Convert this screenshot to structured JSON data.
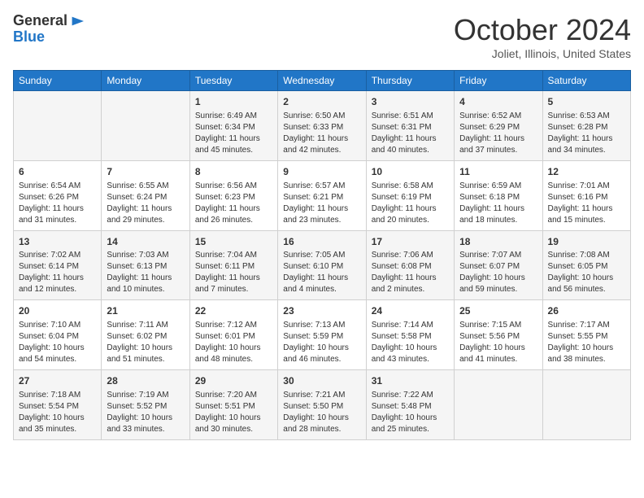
{
  "header": {
    "logo_line1": "General",
    "logo_line2": "Blue",
    "month_title": "October 2024",
    "location": "Joliet, Illinois, United States"
  },
  "days_of_week": [
    "Sunday",
    "Monday",
    "Tuesday",
    "Wednesday",
    "Thursday",
    "Friday",
    "Saturday"
  ],
  "weeks": [
    [
      {
        "day": "",
        "sunrise": "",
        "sunset": "",
        "daylight": ""
      },
      {
        "day": "",
        "sunrise": "",
        "sunset": "",
        "daylight": ""
      },
      {
        "day": "1",
        "sunrise": "Sunrise: 6:49 AM",
        "sunset": "Sunset: 6:34 PM",
        "daylight": "Daylight: 11 hours and 45 minutes."
      },
      {
        "day": "2",
        "sunrise": "Sunrise: 6:50 AM",
        "sunset": "Sunset: 6:33 PM",
        "daylight": "Daylight: 11 hours and 42 minutes."
      },
      {
        "day": "3",
        "sunrise": "Sunrise: 6:51 AM",
        "sunset": "Sunset: 6:31 PM",
        "daylight": "Daylight: 11 hours and 40 minutes."
      },
      {
        "day": "4",
        "sunrise": "Sunrise: 6:52 AM",
        "sunset": "Sunset: 6:29 PM",
        "daylight": "Daylight: 11 hours and 37 minutes."
      },
      {
        "day": "5",
        "sunrise": "Sunrise: 6:53 AM",
        "sunset": "Sunset: 6:28 PM",
        "daylight": "Daylight: 11 hours and 34 minutes."
      }
    ],
    [
      {
        "day": "6",
        "sunrise": "Sunrise: 6:54 AM",
        "sunset": "Sunset: 6:26 PM",
        "daylight": "Daylight: 11 hours and 31 minutes."
      },
      {
        "day": "7",
        "sunrise": "Sunrise: 6:55 AM",
        "sunset": "Sunset: 6:24 PM",
        "daylight": "Daylight: 11 hours and 29 minutes."
      },
      {
        "day": "8",
        "sunrise": "Sunrise: 6:56 AM",
        "sunset": "Sunset: 6:23 PM",
        "daylight": "Daylight: 11 hours and 26 minutes."
      },
      {
        "day": "9",
        "sunrise": "Sunrise: 6:57 AM",
        "sunset": "Sunset: 6:21 PM",
        "daylight": "Daylight: 11 hours and 23 minutes."
      },
      {
        "day": "10",
        "sunrise": "Sunrise: 6:58 AM",
        "sunset": "Sunset: 6:19 PM",
        "daylight": "Daylight: 11 hours and 20 minutes."
      },
      {
        "day": "11",
        "sunrise": "Sunrise: 6:59 AM",
        "sunset": "Sunset: 6:18 PM",
        "daylight": "Daylight: 11 hours and 18 minutes."
      },
      {
        "day": "12",
        "sunrise": "Sunrise: 7:01 AM",
        "sunset": "Sunset: 6:16 PM",
        "daylight": "Daylight: 11 hours and 15 minutes."
      }
    ],
    [
      {
        "day": "13",
        "sunrise": "Sunrise: 7:02 AM",
        "sunset": "Sunset: 6:14 PM",
        "daylight": "Daylight: 11 hours and 12 minutes."
      },
      {
        "day": "14",
        "sunrise": "Sunrise: 7:03 AM",
        "sunset": "Sunset: 6:13 PM",
        "daylight": "Daylight: 11 hours and 10 minutes."
      },
      {
        "day": "15",
        "sunrise": "Sunrise: 7:04 AM",
        "sunset": "Sunset: 6:11 PM",
        "daylight": "Daylight: 11 hours and 7 minutes."
      },
      {
        "day": "16",
        "sunrise": "Sunrise: 7:05 AM",
        "sunset": "Sunset: 6:10 PM",
        "daylight": "Daylight: 11 hours and 4 minutes."
      },
      {
        "day": "17",
        "sunrise": "Sunrise: 7:06 AM",
        "sunset": "Sunset: 6:08 PM",
        "daylight": "Daylight: 11 hours and 2 minutes."
      },
      {
        "day": "18",
        "sunrise": "Sunrise: 7:07 AM",
        "sunset": "Sunset: 6:07 PM",
        "daylight": "Daylight: 10 hours and 59 minutes."
      },
      {
        "day": "19",
        "sunrise": "Sunrise: 7:08 AM",
        "sunset": "Sunset: 6:05 PM",
        "daylight": "Daylight: 10 hours and 56 minutes."
      }
    ],
    [
      {
        "day": "20",
        "sunrise": "Sunrise: 7:10 AM",
        "sunset": "Sunset: 6:04 PM",
        "daylight": "Daylight: 10 hours and 54 minutes."
      },
      {
        "day": "21",
        "sunrise": "Sunrise: 7:11 AM",
        "sunset": "Sunset: 6:02 PM",
        "daylight": "Daylight: 10 hours and 51 minutes."
      },
      {
        "day": "22",
        "sunrise": "Sunrise: 7:12 AM",
        "sunset": "Sunset: 6:01 PM",
        "daylight": "Daylight: 10 hours and 48 minutes."
      },
      {
        "day": "23",
        "sunrise": "Sunrise: 7:13 AM",
        "sunset": "Sunset: 5:59 PM",
        "daylight": "Daylight: 10 hours and 46 minutes."
      },
      {
        "day": "24",
        "sunrise": "Sunrise: 7:14 AM",
        "sunset": "Sunset: 5:58 PM",
        "daylight": "Daylight: 10 hours and 43 minutes."
      },
      {
        "day": "25",
        "sunrise": "Sunrise: 7:15 AM",
        "sunset": "Sunset: 5:56 PM",
        "daylight": "Daylight: 10 hours and 41 minutes."
      },
      {
        "day": "26",
        "sunrise": "Sunrise: 7:17 AM",
        "sunset": "Sunset: 5:55 PM",
        "daylight": "Daylight: 10 hours and 38 minutes."
      }
    ],
    [
      {
        "day": "27",
        "sunrise": "Sunrise: 7:18 AM",
        "sunset": "Sunset: 5:54 PM",
        "daylight": "Daylight: 10 hours and 35 minutes."
      },
      {
        "day": "28",
        "sunrise": "Sunrise: 7:19 AM",
        "sunset": "Sunset: 5:52 PM",
        "daylight": "Daylight: 10 hours and 33 minutes."
      },
      {
        "day": "29",
        "sunrise": "Sunrise: 7:20 AM",
        "sunset": "Sunset: 5:51 PM",
        "daylight": "Daylight: 10 hours and 30 minutes."
      },
      {
        "day": "30",
        "sunrise": "Sunrise: 7:21 AM",
        "sunset": "Sunset: 5:50 PM",
        "daylight": "Daylight: 10 hours and 28 minutes."
      },
      {
        "day": "31",
        "sunrise": "Sunrise: 7:22 AM",
        "sunset": "Sunset: 5:48 PM",
        "daylight": "Daylight: 10 hours and 25 minutes."
      },
      {
        "day": "",
        "sunrise": "",
        "sunset": "",
        "daylight": ""
      },
      {
        "day": "",
        "sunrise": "",
        "sunset": "",
        "daylight": ""
      }
    ]
  ]
}
